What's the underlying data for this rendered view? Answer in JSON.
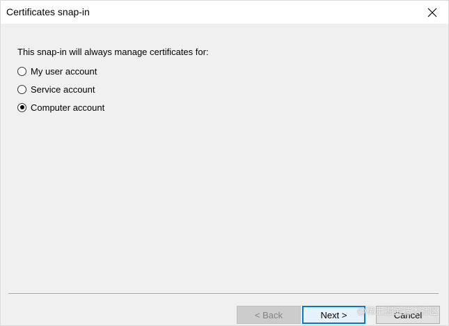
{
  "window": {
    "title": "Certificates snap-in"
  },
  "content": {
    "prompt": "This snap-in will always manage certificates for:",
    "options": [
      {
        "label": "My user account",
        "checked": false
      },
      {
        "label": "Service account",
        "checked": false
      },
      {
        "label": "Computer account",
        "checked": true
      }
    ]
  },
  "buttons": {
    "back": "< Back",
    "next": "Next >",
    "cancel": "Cancel"
  },
  "watermark": "@稀土掘金技术社区",
  "colors": {
    "accent": "#0078d7",
    "dialog_bg": "#f0f0f0",
    "titlebar_bg": "#ffffff"
  }
}
